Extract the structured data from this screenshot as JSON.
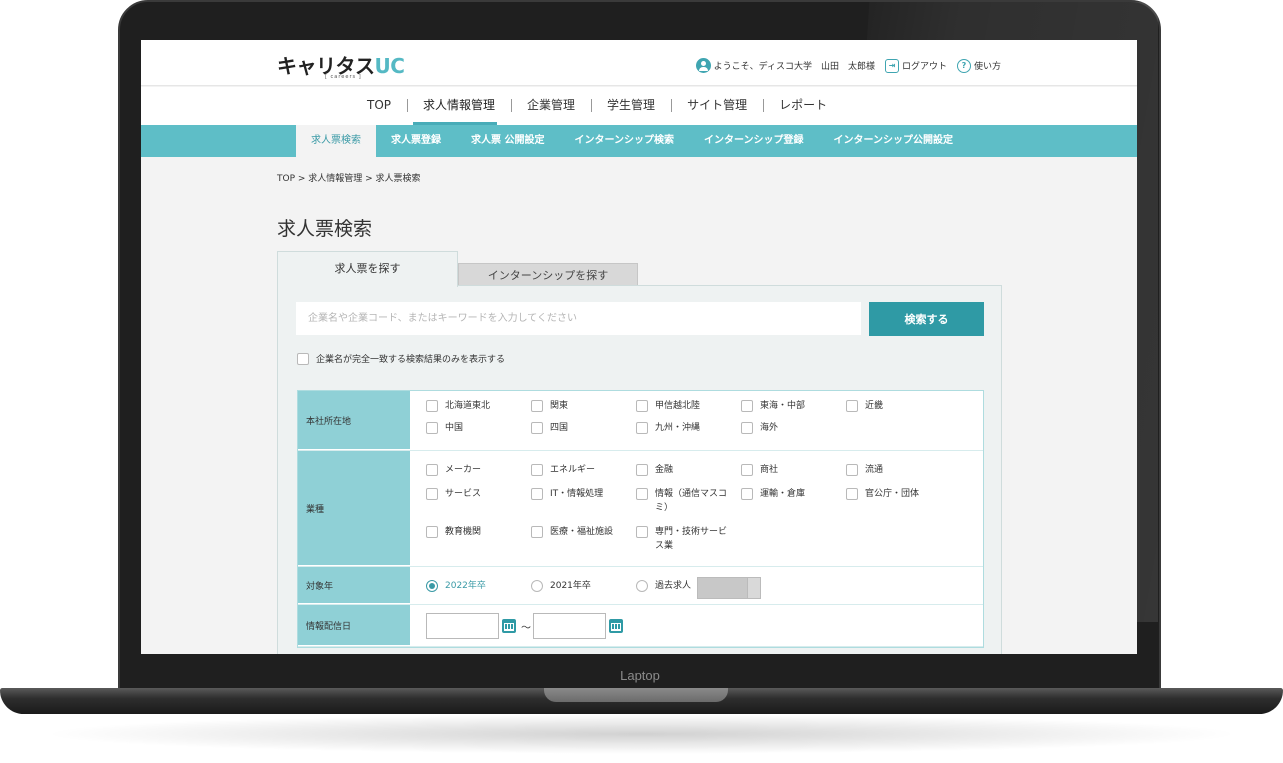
{
  "laptop": {
    "label": "Laptop"
  },
  "header": {
    "logo_main": "キャリタス",
    "logo_uc": "UC",
    "logo_sub": "[ careers ]",
    "welcome": "ようこそ、ディスコ大学　山田　太郎様",
    "logout": "ログアウト",
    "help": "使い方"
  },
  "main_nav": {
    "items": [
      {
        "label": "TOP"
      },
      {
        "label": "求人情報管理",
        "active": true
      },
      {
        "label": "企業管理"
      },
      {
        "label": "学生管理"
      },
      {
        "label": "サイト管理"
      },
      {
        "label": "レポート"
      }
    ]
  },
  "sub_nav": {
    "items": [
      {
        "label": "求人票検索",
        "active": true
      },
      {
        "label": "求人票登録"
      },
      {
        "label": "求人票 公開設定"
      },
      {
        "label": "インターンシップ検索"
      },
      {
        "label": "インターンシップ登録"
      },
      {
        "label": "インターンシップ公開設定"
      }
    ]
  },
  "breadcrumb": "TOP > 求人情報管理 > 求人票検索",
  "page_title": "求人票検索",
  "tabs": [
    {
      "label": "求人票を探す",
      "active": true
    },
    {
      "label": "インターンシップを探す"
    }
  ],
  "search": {
    "placeholder": "企業名や企業コード、またはキーワードを入力してください",
    "value": "",
    "button": "検索する",
    "exact_match_label": "企業名が完全一致する検索結果のみを表示する",
    "exact_match_checked": false
  },
  "filters": {
    "region": {
      "label": "本社所在地",
      "options": [
        "北海道東北",
        "関東",
        "甲信越北陸",
        "東海・中部",
        "近畿",
        "中国",
        "四国",
        "九州・沖縄",
        "海外"
      ]
    },
    "industry": {
      "label": "業種",
      "options": [
        "メーカー",
        "エネルギー",
        "金融",
        "商社",
        "流通",
        "サービス",
        "IT・情報処理",
        "情報（通信マスコミ）",
        "運輸・倉庫",
        "官公庁・団体",
        "教育機関",
        "医療・福祉施設",
        "専門・技術サービス業"
      ]
    },
    "year": {
      "label": "対象年",
      "options": [
        "2022年卒",
        "2021年卒",
        "過去求人"
      ],
      "selected": "2022年卒"
    },
    "date": {
      "label": "情報配信日",
      "separator": "～",
      "from": "",
      "to": ""
    }
  },
  "colors": {
    "accent": "#5ebec7",
    "accent_dark": "#2f9aa5",
    "label_bg": "#8fd0d6"
  }
}
